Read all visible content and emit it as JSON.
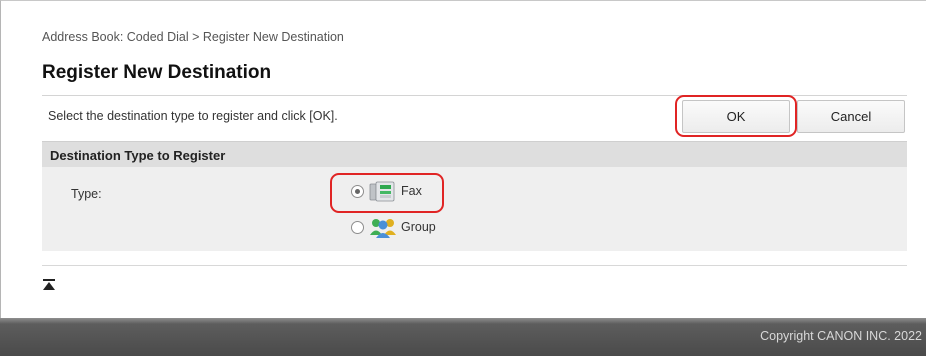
{
  "breadcrumb": "Address Book: Coded Dial > Register New Destination",
  "page_title": "Register New Destination",
  "instruction": "Select the destination type to register and click [OK].",
  "buttons": {
    "ok": "OK",
    "cancel": "Cancel"
  },
  "section": {
    "title": "Destination Type to Register",
    "type_label": "Type:",
    "options": [
      {
        "label": "Fax",
        "icon": "fax-icon",
        "selected": true
      },
      {
        "label": "Group",
        "icon": "group-icon",
        "selected": false
      }
    ]
  },
  "footer": {
    "copyright": "Copyright CANON INC. 2022"
  },
  "colors": {
    "highlight": "#e02424",
    "footer": "#4a4a4a",
    "section_bg": "#efefef"
  }
}
